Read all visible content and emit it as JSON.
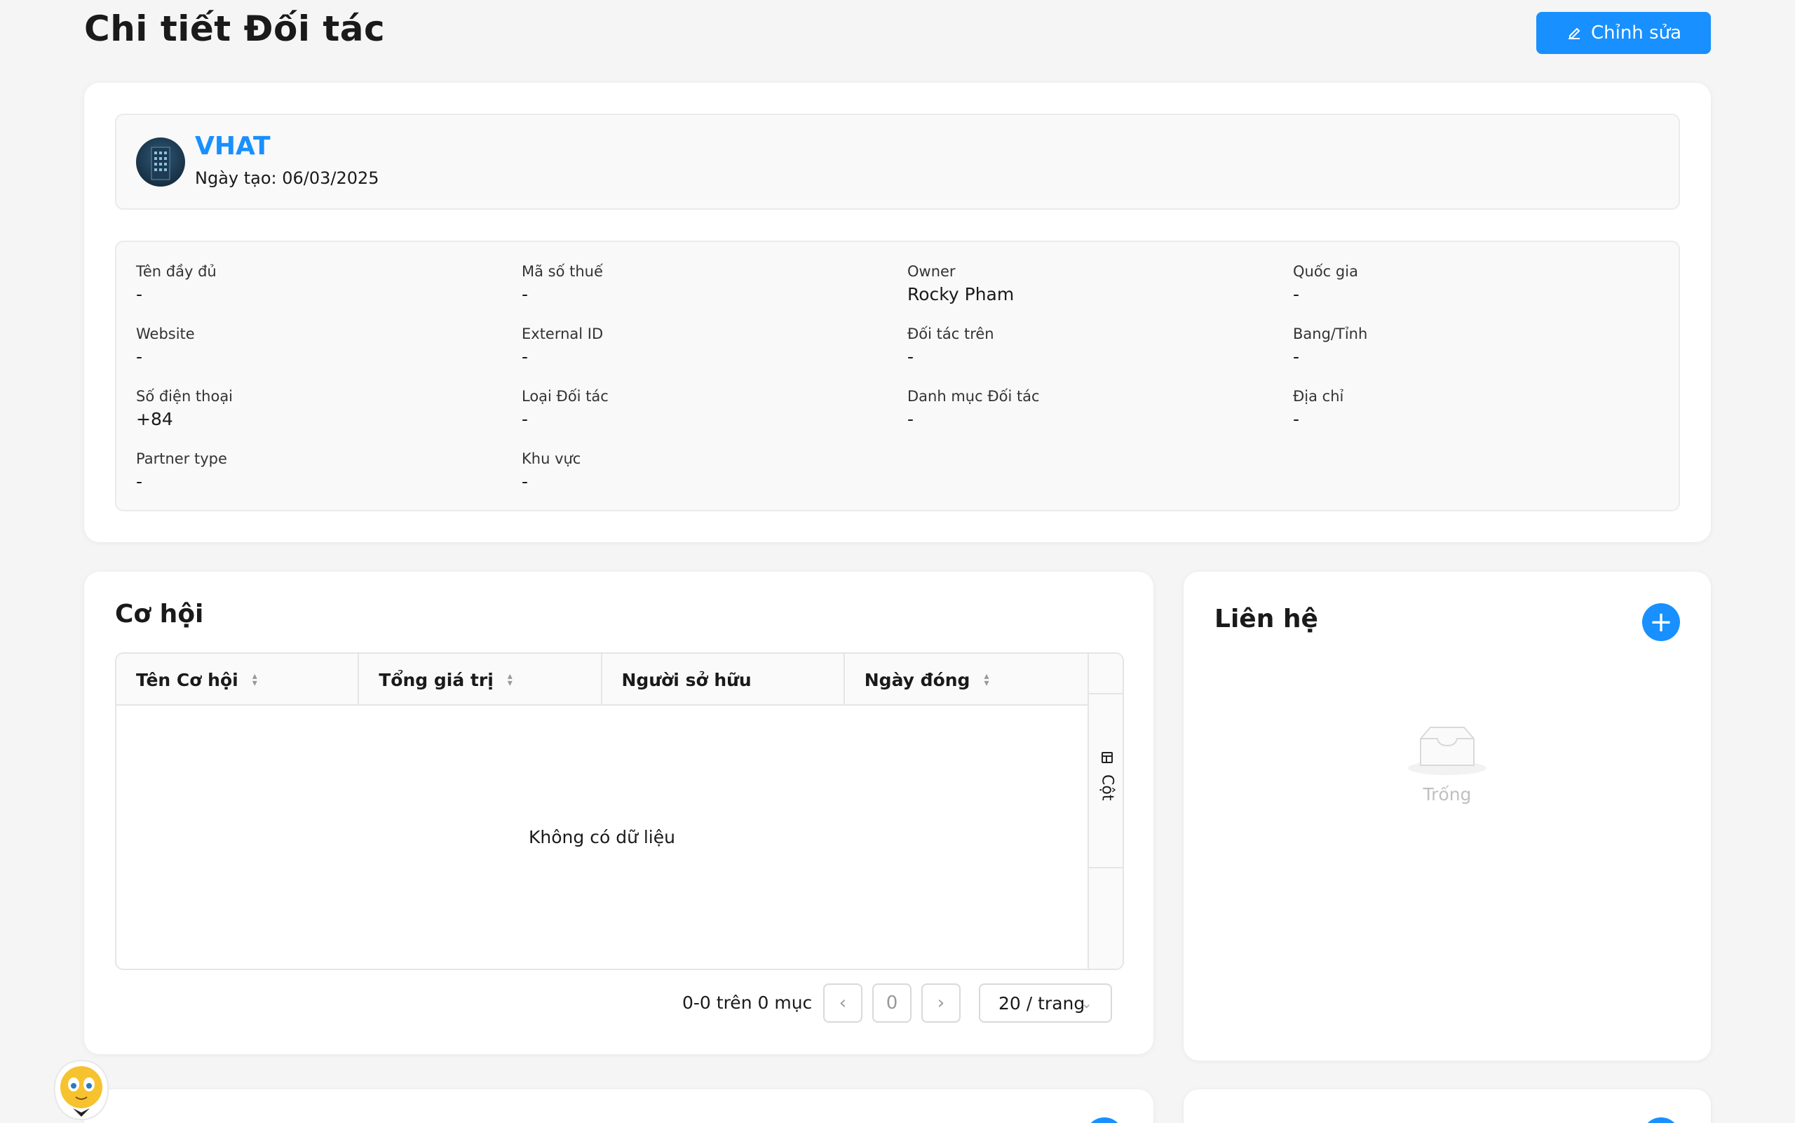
{
  "page": {
    "title": "Chi tiết Đối tác",
    "edit_label": "Chỉnh sửa"
  },
  "partner": {
    "name": "VHAT",
    "created": "Ngày tạo: 06/03/2025"
  },
  "fields": [
    {
      "label": "Tên đầy đủ",
      "value": "-"
    },
    {
      "label": "Mã số thuế",
      "value": "-"
    },
    {
      "label": "Owner",
      "value": "Rocky Pham"
    },
    {
      "label": "Quốc gia",
      "value": "-"
    },
    {
      "label": "Website",
      "value": "-"
    },
    {
      "label": "External ID",
      "value": "-"
    },
    {
      "label": "Đối tác trên",
      "value": "-"
    },
    {
      "label": "Bang/Tỉnh",
      "value": "-"
    },
    {
      "label": "Số điện thoại",
      "value": "+84"
    },
    {
      "label": "Loại Đối tác",
      "value": "-"
    },
    {
      "label": "Danh mục Đối tác",
      "value": "-"
    },
    {
      "label": "Địa chỉ",
      "value": "-"
    },
    {
      "label": "Partner type",
      "value": "-"
    },
    {
      "label": "Khu vực",
      "value": "-"
    }
  ],
  "opportunities": {
    "title": "Cơ hội",
    "columns": [
      "Tên Cơ hội",
      "Tổng giá trị",
      "Người sở hữu",
      "Ngày đóng"
    ],
    "empty": "Không có dữ liệu",
    "column_toggle": "Cột",
    "pagination": {
      "summary": "0-0 trên 0 mục",
      "page": "0",
      "page_size": "20 / trang"
    }
  },
  "contacts": {
    "title": "Liên hệ",
    "empty": "Trống"
  },
  "icons": [
    "edit-icon",
    "building-avatar-icon",
    "sort-icon",
    "table-columns-icon",
    "chevron-left-icon",
    "chevron-right-icon",
    "chevron-down-icon",
    "plus-icon",
    "empty-inbox-icon",
    "mascot-icon"
  ],
  "colors": {
    "accent": "#1890ff",
    "background": "#f5f5f5"
  }
}
